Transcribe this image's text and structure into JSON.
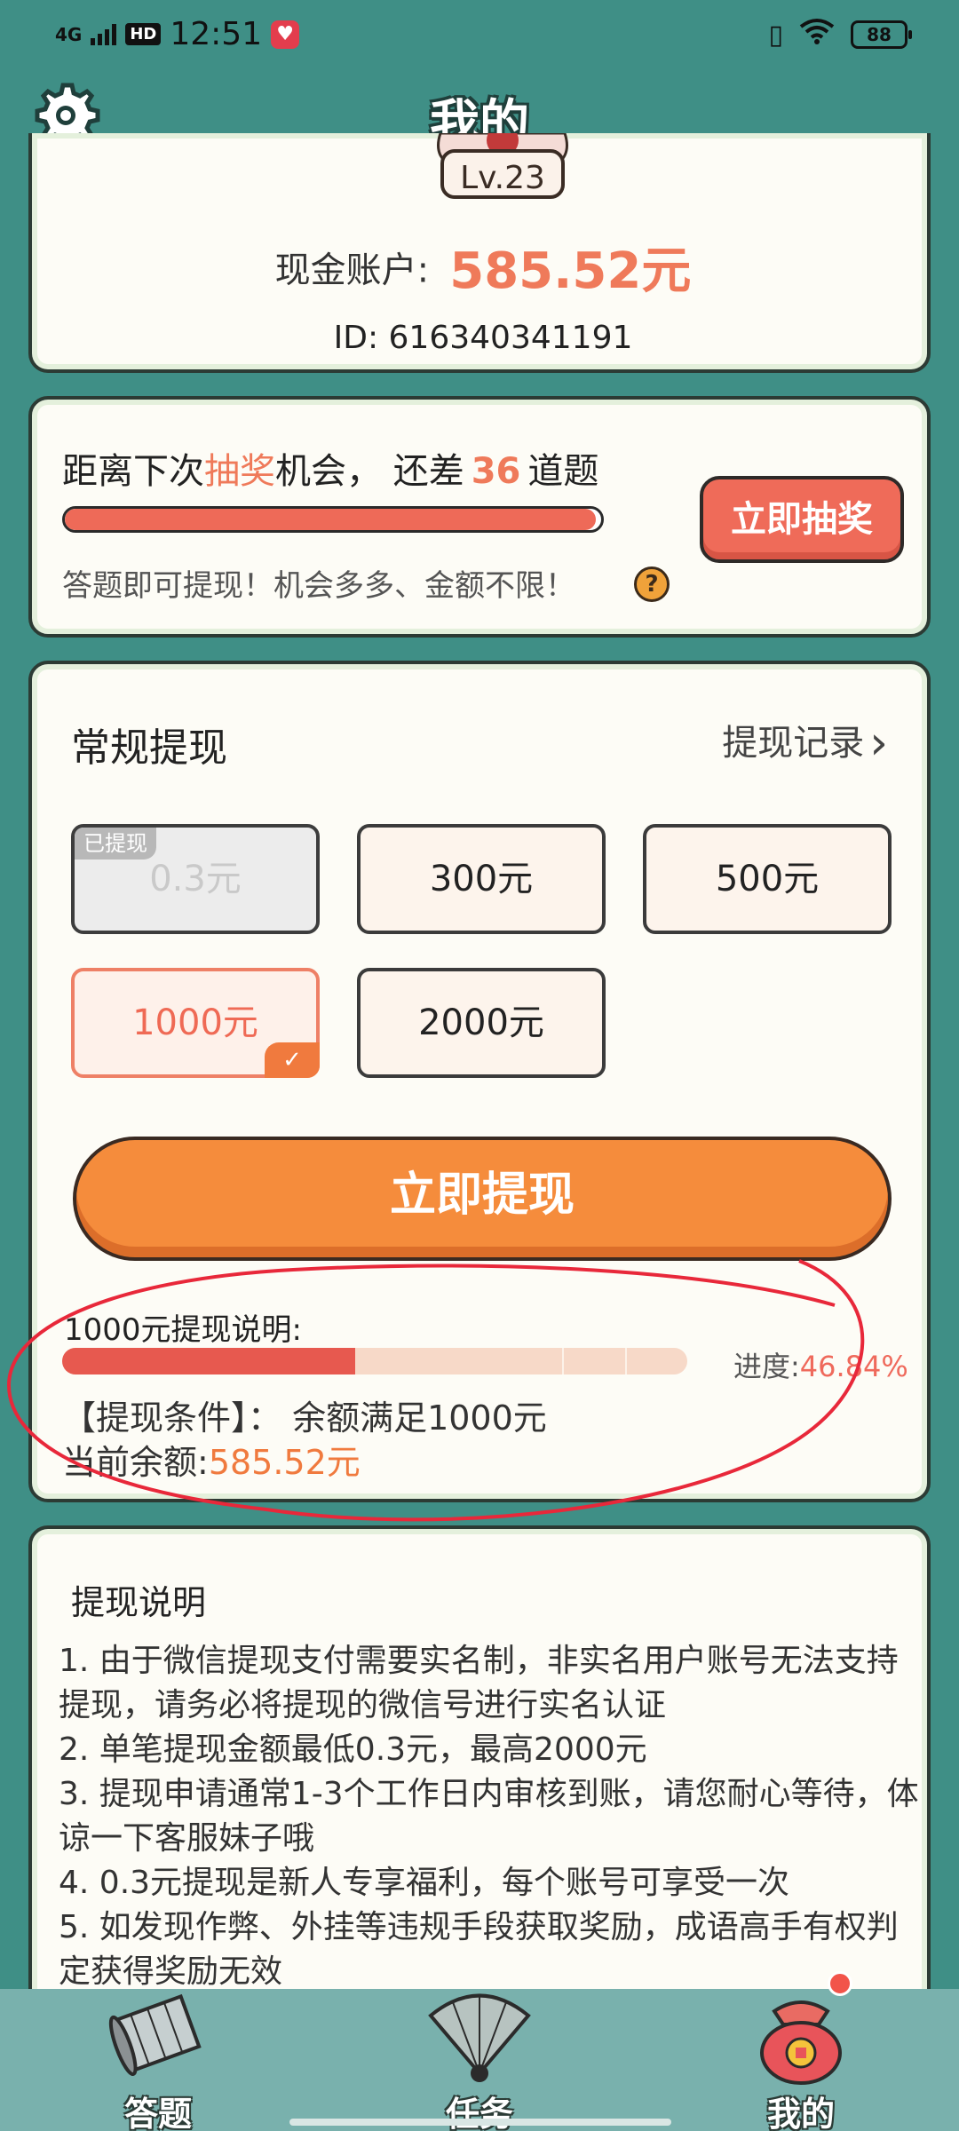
{
  "status_bar": {
    "network": "4G",
    "hd": "HD",
    "time": "12:51",
    "battery": "88"
  },
  "header": {
    "title": "我的"
  },
  "account": {
    "level": "Lv.23",
    "cash_label": "现金账户:",
    "cash_value": "585.52元",
    "user_id": "ID: 616340341191"
  },
  "lottery": {
    "text_before": "距离下次",
    "text_highlight": "抽奖",
    "text_middle": "机会， 还差",
    "remaining": "36",
    "text_after": "道题",
    "progress": 0.99,
    "button_label": "立即抽奖",
    "tip": "答题即可提现！机会多多、金额不限！",
    "help_symbol": "?"
  },
  "withdraw": {
    "title": "常规提现",
    "history_link": "提现记录",
    "history_chevron": "›",
    "used_tag": "已提现",
    "amounts": [
      {
        "label": "0.3元",
        "state": "used"
      },
      {
        "label": "300元",
        "state": "normal"
      },
      {
        "label": "500元",
        "state": "normal"
      },
      {
        "label": "1000元",
        "state": "selected"
      },
      {
        "label": "2000元",
        "state": "normal"
      }
    ],
    "check_symbol": "✓",
    "button_label": "立即提现",
    "explain_title": "1000元提现说明:",
    "progress_label": "进度:",
    "progress_value": "46.84%",
    "progress": 0.4684,
    "condition": "【提现条件】：  余额满足1000元",
    "balance_label": "当前余额:",
    "balance_value": "585.52元"
  },
  "notes": {
    "title": "提现说明",
    "items": [
      "1. 由于微信提现支付需要实名制，非实名用户账号无法支持提现，请务必将提现的微信号进行实名认证",
      "2. 单笔提现金额最低0.3元，最高2000元",
      "3. 提现申请通常1-3个工作日内审核到账，请您耐心等待，体谅一下客服妹子哦",
      "4. 0.3元提现是新人专享福利，每个账号可享受一次",
      "5. 如发现作弊、外挂等违规手段获取奖励，成语高手有权判定获得奖励无效"
    ]
  },
  "bottom_nav": {
    "items": [
      {
        "label": "答题",
        "icon": "scroll-icon"
      },
      {
        "label": "任务",
        "icon": "fan-icon"
      },
      {
        "label": "我的",
        "icon": "lucky-bag-icon"
      }
    ]
  },
  "colors": {
    "background": "#3f8f86",
    "accent_orange": "#f58c3c",
    "accent_red": "#ef6b59",
    "highlight_text": "#ef7a5a"
  }
}
